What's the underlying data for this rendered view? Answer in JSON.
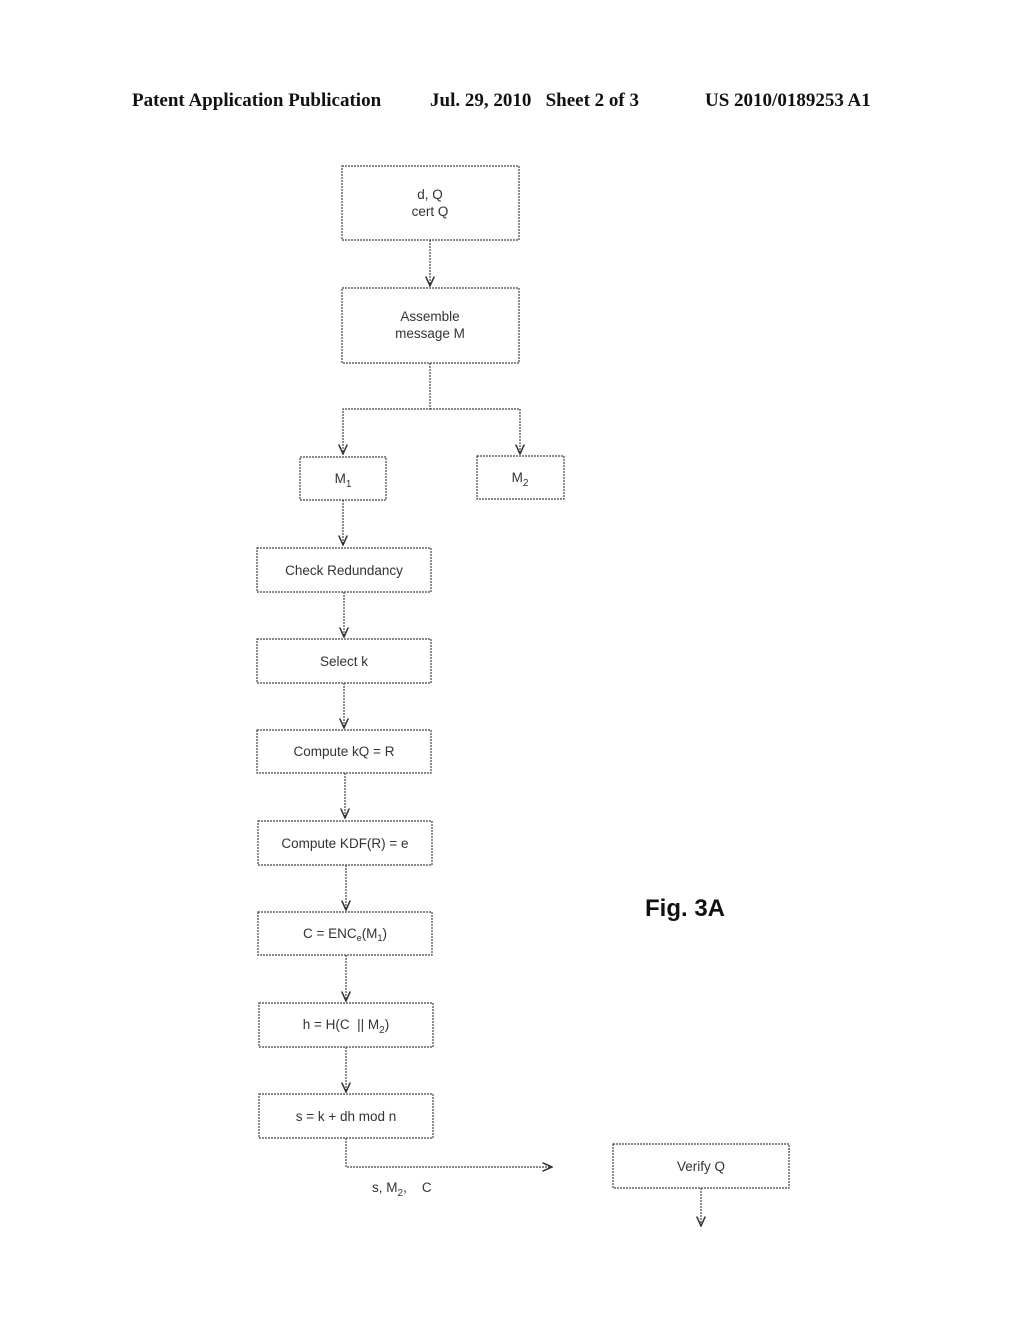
{
  "header": {
    "publication": "Patent Application Publication",
    "date_sheet": "Jul. 29, 2010   Sheet 2 of 3",
    "number": "US 2010/0189253 A1"
  },
  "figure_label": "Fig. 3A",
  "boxes": {
    "keys": {
      "line1": "d, Q",
      "line2": "cert Q"
    },
    "assemble": {
      "line1": "Assemble",
      "line2": "message M"
    },
    "m1": {
      "base": "M",
      "sub": "1"
    },
    "m2": {
      "base": "M",
      "sub": "2"
    },
    "check_redundancy": "Check Redundancy",
    "select_k": "Select k",
    "compute_r": "Compute kQ = R",
    "compute_e": "Compute KDF(R) = e",
    "encrypt": {
      "pre": "C = ENC",
      "sub": "e",
      "post": "(M",
      "sub2": "1",
      "end": ")"
    },
    "hash": {
      "pre": "h = H(C  || M",
      "sub": "2",
      "end": ")"
    },
    "signature": "s = k + dh mod n",
    "verify": "Verify Q"
  },
  "transmission_label": {
    "pre": "s, M",
    "sub": "2",
    "post": ",    C"
  }
}
